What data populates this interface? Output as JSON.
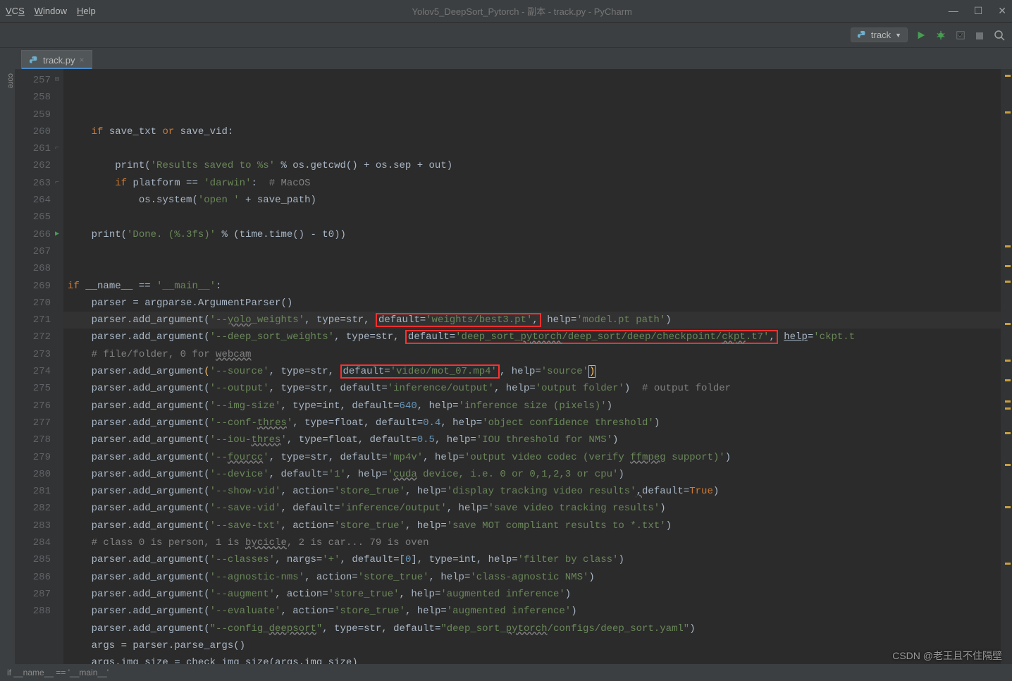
{
  "menus": {
    "vcs": "VCS",
    "window": "Window",
    "help": "Help"
  },
  "title": "Yolov5_DeepSort_Pytorch - 副本 - track.py - PyCharm",
  "run_config": "track",
  "tab": {
    "name": "track.py"
  },
  "side_label": "core",
  "lines": {
    "start": 257,
    "count": 32
  },
  "code": {
    "l257": {
      "if": "if",
      "v1": "save_txt",
      "or": "or",
      "v2": "save_vid"
    },
    "l259": {
      "fn": "print",
      "s1": "'Results saved to %s'",
      "op": " % os.getcwd() + os.sep + out)"
    },
    "l260": {
      "if": "if",
      "v": "platform == ",
      "s": "'darwin'",
      "cmt": "# MacOS"
    },
    "l261": {
      "a": "os.system(",
      "s": "'open '",
      "b": " + save_path)"
    },
    "l263": {
      "fn": "print",
      "s": "'Done. (%.3fs)'",
      "b": " % (time.time() - t0))"
    },
    "l266": {
      "if": "if",
      "a": " __name__ == ",
      "s": "'__main__'"
    },
    "l267": "    parser = argparse.ArgumentParser()",
    "l268": {
      "a": "    parser.add_argument(",
      "s1": "'--",
      "ul": "yolo",
      "s1b": "_weights'",
      "b": ", ",
      "t": "type",
      "c": "=str, ",
      "rb": "default=",
      "rs": "'weights/best3.pt'",
      "rc": ",",
      "d": " ",
      "h": "help",
      "e": "=",
      "hs": "'model.pt path'",
      "f": ")"
    },
    "l269": {
      "a": "    parser.add_argument(",
      "s1": "'--deep_sort_weights'",
      "b": ", ",
      "t": "type",
      "c": "=str, ",
      "rb": "default=",
      "rs": "'deep_sort_",
      "ru": "pytorch",
      "rs2": "/deep_sort/deep/checkpoint/",
      "ru2": "ckpt",
      "rs3": ".t7'",
      "rc": ",",
      "d": " ",
      "h": "help",
      "e": "=",
      "hs": "'ckpt.t",
      "f": ""
    },
    "l270": {
      "cmt": "# file/folder, 0 for ",
      "ul": "webcam"
    },
    "l271": {
      "a": "    parser.add_argument",
      "p": "(",
      "s1": "'--source'",
      "b": ", ",
      "t": "type",
      "c": "=str, ",
      "rb": "default=",
      "rs": "'video/mot_07.mp4'",
      "rc": ",",
      "d": " ",
      "h": "help",
      "e": "=",
      "hs": "'source'",
      "f": ")"
    },
    "l272": {
      "a": "    parser.add_argument(",
      "s1": "'--output'",
      "b": ", ",
      "t": "type",
      "c": "=str, ",
      "db": "default",
      "de": "=",
      "ds": "'inference/output'",
      "dc": ", ",
      "h": "help",
      "e": "=",
      "hs": "'output folder'",
      "f": ")  ",
      "cmt": "# output folder"
    },
    "l273": {
      "a": "    parser.add_argument(",
      "s1": "'--img-size'",
      "b": ", ",
      "t": "type",
      "c": "=int, ",
      "db": "default",
      "de": "=",
      "dn": "640",
      "dc": ", ",
      "h": "help",
      "e": "=",
      "hs": "'inference size (pixels)'",
      "f": ")"
    },
    "l274": {
      "a": "    parser.add_argument(",
      "s1": "'--conf-",
      "ul": "thres",
      "s1b": "'",
      "b": ", ",
      "t": "type",
      "c": "=float, ",
      "db": "default",
      "de": "=",
      "dn": "0.4",
      "dc": ", ",
      "h": "help",
      "e": "=",
      "hs": "'object confidence threshold'",
      "f": ")"
    },
    "l275": {
      "a": "    parser.add_argument(",
      "s1": "'--iou-",
      "ul": "thres",
      "s1b": "'",
      "b": ", ",
      "t": "type",
      "c": "=float, ",
      "db": "default",
      "de": "=",
      "dn": "0.5",
      "dc": ", ",
      "h": "help",
      "e": "=",
      "hs": "'IOU threshold for NMS'",
      "f": ")"
    },
    "l276": {
      "a": "    parser.add_argument(",
      "s1": "'--",
      "ul": "fourcc",
      "s1b": "'",
      "b": ", ",
      "t": "type",
      "c": "=str, ",
      "db": "default",
      "de": "=",
      "ds": "'mp4v'",
      "dc": ", ",
      "h": "help",
      "e": "=",
      "hs": "'output video codec (verify ",
      "hu": "ffmpeg",
      "hs2": " support)'",
      "f": ")"
    },
    "l277": {
      "a": "    parser.add_argument(",
      "s1": "'--device'",
      "b": ", ",
      "db": "default",
      "de": "=",
      "ds": "'1'",
      "dc": ", ",
      "h": "help",
      "e": "=",
      "hs": "'",
      "hu": "cuda",
      "hs2": " device, i.e. 0 or 0,1,2,3 or cpu'",
      "f": ")"
    },
    "l278": {
      "a": "    parser.add_argument(",
      "s1": "'--show-vid'",
      "b": ", ",
      "ac": "action",
      "de": "=",
      "ds": "'store_true'",
      "dc": ", ",
      "h": "help",
      "e": "=",
      "hs": "'display tracking video results'",
      "xc": ",",
      "db2": "default",
      "de2": "=",
      "tv": "True",
      "f": ")"
    },
    "l279": {
      "a": "    parser.add_argument(",
      "s1": "'--save-vid'",
      "b": ", ",
      "db": "default",
      "de": "=",
      "ds": "'inference/output'",
      "dc": ", ",
      "h": "help",
      "e": "=",
      "hs": "'save video tracking results'",
      "f": ")"
    },
    "l280": {
      "a": "    parser.add_argument(",
      "s1": "'--save-txt'",
      "b": ", ",
      "ac": "action",
      "de": "=",
      "ds": "'store_true'",
      "dc": ", ",
      "h": "help",
      "e": "=",
      "hs": "'save MOT compliant results to *.txt'",
      "f": ")"
    },
    "l281": {
      "cmt": "# class 0 is person, 1 is ",
      "ul": "bycicle",
      "cmt2": ", 2 is car... 79 is oven"
    },
    "l282": {
      "a": "    parser.add_argument(",
      "s1": "'--classes'",
      "b": ", ",
      "n": "nargs",
      "de": "=",
      "ns": "'+'",
      "dc": ", ",
      "db": "default",
      "de2": "=[",
      "dn": "0",
      "dc2": "], ",
      "t": "type",
      "c": "=int, ",
      "h": "help",
      "e": "=",
      "hs": "'filter by class'",
      "f": ")"
    },
    "l283": {
      "a": "    parser.add_argument(",
      "s1": "'--agnostic-nms'",
      "b": ", ",
      "ac": "action",
      "de": "=",
      "ds": "'store_true'",
      "dc": ", ",
      "h": "help",
      "e": "=",
      "hs": "'class-agnostic NMS'",
      "f": ")"
    },
    "l284": {
      "a": "    parser.add_argument(",
      "s1": "'--augment'",
      "b": ", ",
      "ac": "action",
      "de": "=",
      "ds": "'store_true'",
      "dc": ", ",
      "h": "help",
      "e": "=",
      "hs": "'augmented inference'",
      "f": ")"
    },
    "l285": {
      "a": "    parser.add_argument(",
      "s1": "'--evaluate'",
      "b": ", ",
      "ac": "action",
      "de": "=",
      "ds": "'store_true'",
      "dc": ", ",
      "h": "help",
      "e": "=",
      "hs": "'augmented inference'",
      "f": ")"
    },
    "l286": {
      "a": "    parser.add_argument(",
      "s1": "\"--config_",
      "ul": "deepsort",
      "s1b": "\"",
      "b": ", ",
      "t": "type",
      "c": "=str, ",
      "db": "default",
      "de": "=",
      "ds": "\"deep_sort_",
      "du": "pytorch",
      "ds2": "/configs/deep_sort.yaml\"",
      "f": ")"
    },
    "l287": "    args = parser.parse_args()",
    "l288": "    args.img_size = check_img_size(args.img_size)"
  },
  "breadcrumb": "if __name__ == '__main__'",
  "watermark": "CSDN @老王且不住隔壁"
}
